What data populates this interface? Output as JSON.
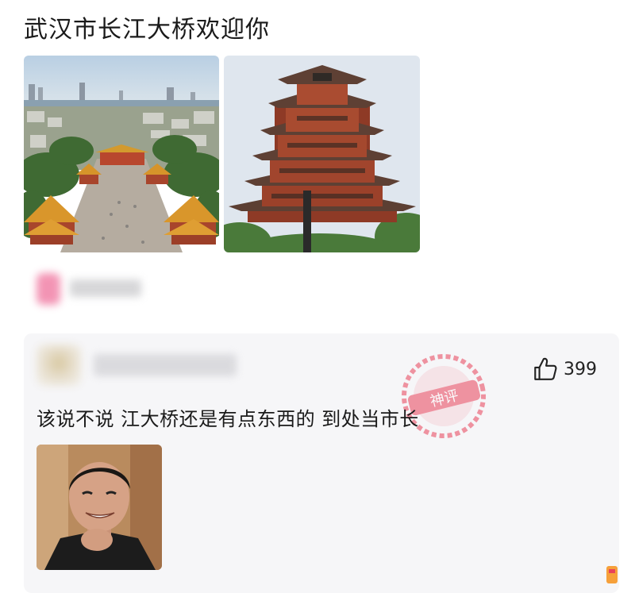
{
  "post": {
    "title": "武汉市长江大桥欢迎你",
    "images": [
      {
        "icon": "wuhan-city-aerial-image"
      },
      {
        "icon": "yellow-crane-tower-image"
      }
    ]
  },
  "comment": {
    "like_count": "399",
    "like_icon": "thumbs-up-icon",
    "text": "该说不说 江大桥还是有点东西的 到处当市长",
    "meme_icon": "smiling-man-meme-image",
    "watermark": "神评"
  },
  "colors": {
    "title_text": "#1a1a1a",
    "card_bg": "#f6f6f8",
    "watermark_red": "#e8425a"
  }
}
